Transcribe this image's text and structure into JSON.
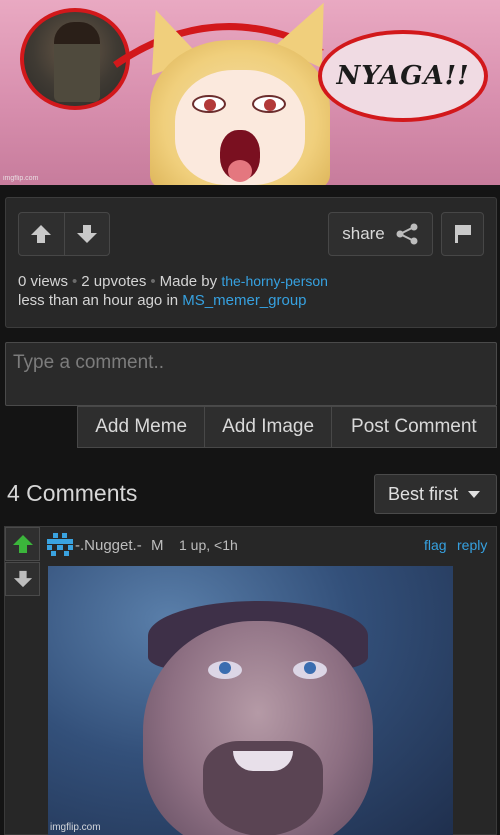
{
  "meme": {
    "caption_text": "NYAGA!!",
    "watermark": "imgflip.com"
  },
  "post": {
    "vote_up_icon": "arrow-up-icon",
    "vote_down_icon": "arrow-down-icon",
    "share_label": "share",
    "flag_icon": "flag-icon",
    "views": "0 views",
    "upvotes": "2 upvotes",
    "made_by_prefix": "Made by",
    "author": "the-horny-person",
    "time_prefix": "less than an hour ago in",
    "group": "MS_memer_group"
  },
  "comment_form": {
    "placeholder": "Type a comment..",
    "add_meme_label": "Add Meme",
    "add_image_label": "Add Image",
    "post_comment_label": "Post Comment"
  },
  "comments": {
    "title": "4 Comments",
    "sort_selected": "Best first",
    "items": [
      {
        "username": "-.Nugget.-",
        "badge": "M",
        "stats": "1 up, <1h",
        "flag_label": "flag",
        "reply_label": "reply",
        "image_watermark": "imgflip.com"
      }
    ]
  },
  "colors": {
    "background": "#141414",
    "panel": "#282828",
    "link": "#36a1e0",
    "upvote_active": "#3bb53b",
    "highlight_red": "#d2181b"
  }
}
